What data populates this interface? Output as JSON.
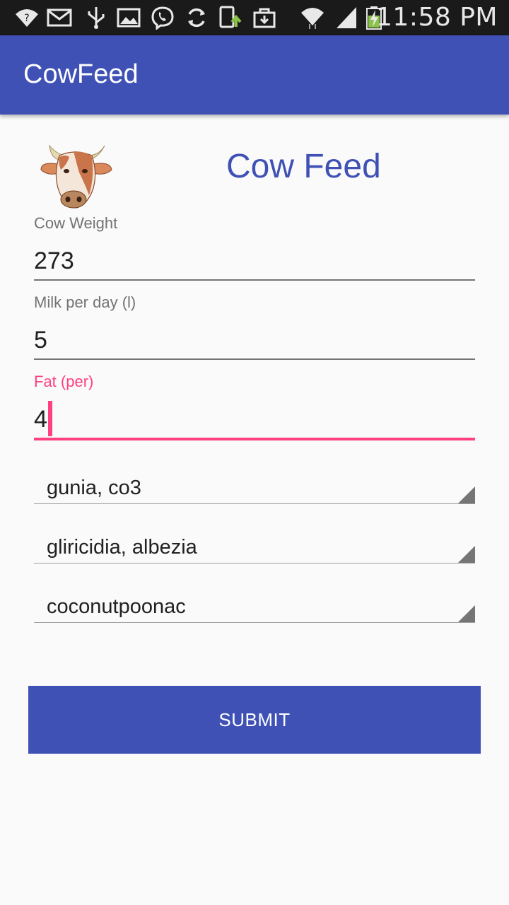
{
  "status_bar": {
    "time": "11:58 PM",
    "icons": [
      "wifi-question-icon",
      "mail-icon",
      "usb-icon",
      "image-icon",
      "viber-icon",
      "sync-icon",
      "phone-upload-icon",
      "bag-icon",
      "wifi-icon",
      "signal-icon",
      "battery-charging-icon"
    ]
  },
  "app_bar": {
    "title": "CowFeed"
  },
  "header": {
    "title": "Cow Feed",
    "image": "cow-head-icon"
  },
  "form": {
    "weight": {
      "label": "Cow Weight",
      "value": "273"
    },
    "milk": {
      "label": "Milk per day (l)",
      "value": "5"
    },
    "fat": {
      "label": "Fat (per)",
      "value": "4"
    }
  },
  "spinners": [
    {
      "selected": "gunia, co3"
    },
    {
      "selected": "gliricidia, albezia"
    },
    {
      "selected": "coconutpoonac"
    }
  ],
  "submit": {
    "label": "SUBMIT"
  },
  "colors": {
    "primary": "#3f51b5",
    "accent": "#ff4081",
    "status_bar": "#1a1a1a"
  }
}
